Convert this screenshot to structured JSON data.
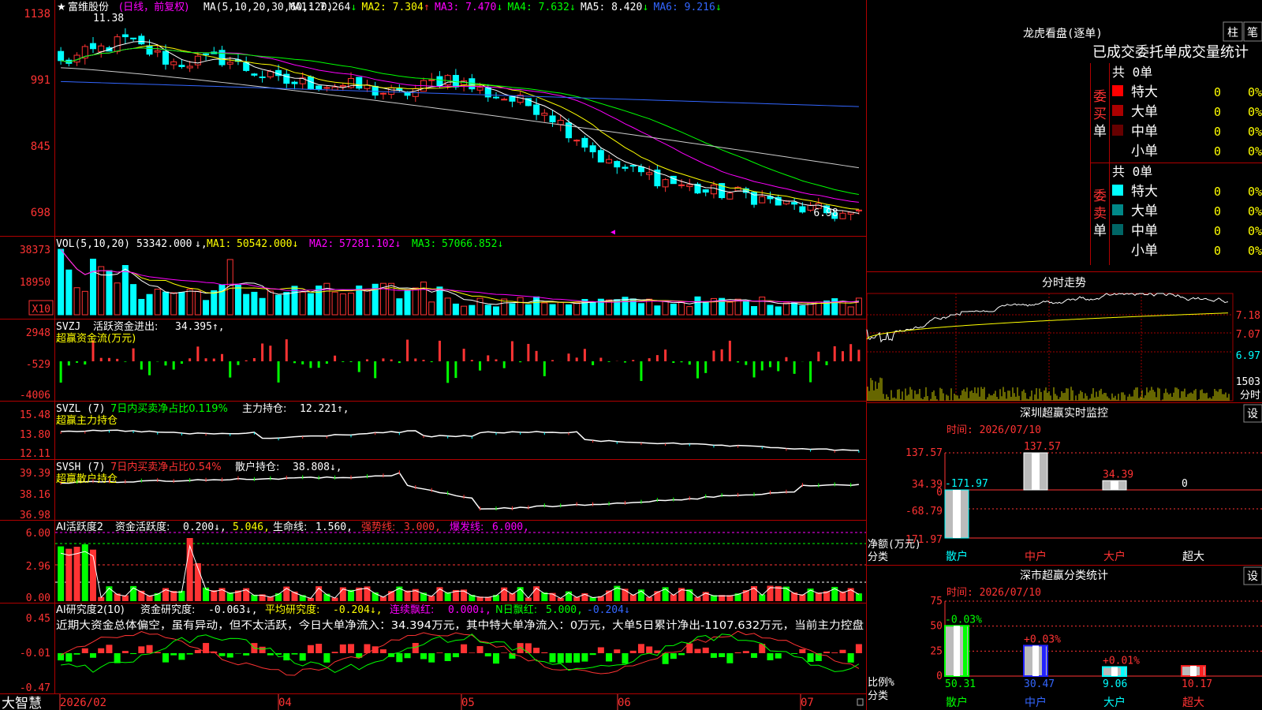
{
  "colors": {
    "up": "#ff3333",
    "down": "#00ffff",
    "grid": "#a00000",
    "yellow": "#ffff00",
    "green": "#00ff00",
    "magenta": "#ff00ff",
    "white": "#ffffff",
    "blue": "#3366ff"
  },
  "stock": {
    "name": "富维股份",
    "period": "(日线，前复权)",
    "ma_label": "MA(5,10,20,30,60,120)",
    "ma_values": [
      {
        "label": "MA1:",
        "value": "7.264",
        "arrow": "↓"
      },
      {
        "label": "MA2:",
        "value": "7.304",
        "arrow": "↑"
      },
      {
        "label": "MA3:",
        "value": "7.470",
        "arrow": "↓"
      },
      {
        "label": "MA4:",
        "value": "7.632",
        "arrow": "↓"
      },
      {
        "label": "MA5:",
        "value": "8.420",
        "arrow": "↓"
      },
      {
        "label": "MA6:",
        "value": "9.216",
        "arrow": "↓"
      }
    ],
    "high_mark": "11.38",
    "low_mark": "6.98"
  },
  "axes": {
    "price": [
      "1138",
      "991",
      "845",
      "698"
    ],
    "vol": [
      "38373",
      "18950",
      "X10"
    ],
    "svzj": [
      "2948",
      "-529",
      "-4006"
    ],
    "svzl": [
      "15.48",
      "13.80",
      "12.11"
    ],
    "svsh": [
      "39.39",
      "38.16",
      "36.98"
    ],
    "ai1": [
      "6.00",
      "2.96",
      "0.00"
    ],
    "ai2": [
      "0.45",
      "-0.01",
      "-0.47"
    ]
  },
  "dates": [
    "2026/02",
    "04",
    "05",
    "06",
    "07"
  ],
  "brand": "大智慧",
  "vol_header": {
    "title": "VOL(5,10,20)",
    "value": "53342.000",
    "ma1": "MA1:",
    "ma1v": "50542.000↓",
    "ma2": "MA2:",
    "ma2v": "57281.102↓",
    "ma3": "MA3:",
    "ma3v": "57066.852↓"
  },
  "svzj_header": {
    "title": "SVZJ",
    "label": "活跃资金进出:",
    "value": "34.395↑,",
    "sub": "超赢资金流(万元)"
  },
  "svzl_header": {
    "title": "SVZL (7)",
    "label": "7日内买卖净占比0.119%",
    "label2": "主力持仓:",
    "value": "12.221↑,",
    "sub": "超赢主力持仓"
  },
  "svsh_header": {
    "title": "SVSH (7)",
    "label": "7日内买卖净占比0.54%",
    "label2": "散户持仓:",
    "value": "38.808↓,",
    "sub": "超赢散户持仓"
  },
  "ai1_header": {
    "title": "AI活跃度2",
    "label": "资金活跃度:",
    "value": "0.200↓,",
    "v2": "5.046,",
    "label2": "生命线:",
    "v3": "1.560,",
    "label3": "强势线:",
    "v4": "3.000,",
    "label4": "爆发线:",
    "v5": "6.000,"
  },
  "ai2_header": {
    "title": "AI研究度2(10)",
    "label": "资金研究度:",
    "value": "-0.063↓,",
    "label2": "平均研究度:",
    "v2": "-0.204↓,",
    "label3": "连续飘红:",
    "v3": "0.000↓,",
    "label4": "N日飘红:",
    "v4": "5.000,",
    "v5": "-0.204↓"
  },
  "ai2_comment": "近期大资金总体偏空，虽有异动，但不太活跃，今日大单净流入：34.394万元，其中特大单净流入：0万元，大单5日累计净出-1107.632万元，当前主力控盘",
  "dragon": {
    "title": "龙虎看盘(逐单)",
    "btn1": "柱",
    "btn2": "笔",
    "subtitle": "已成交委托单成交量统计",
    "buy_label": "委买单",
    "buy_total": "共 0单",
    "sell_label": "委卖单",
    "sell_total": "共 0单",
    "buy_rows": [
      {
        "name": "特大",
        "count": "0",
        "pct": "0%",
        "color": "#ff0000"
      },
      {
        "name": "大单",
        "count": "0",
        "pct": "0%",
        "color": "#aa0000"
      },
      {
        "name": "中单",
        "count": "0",
        "pct": "0%",
        "color": "#660000"
      },
      {
        "name": "小单",
        "count": "0",
        "pct": "0%",
        "color": ""
      }
    ],
    "sell_rows": [
      {
        "name": "特大",
        "count": "0",
        "pct": "0%",
        "color": "#00ffff"
      },
      {
        "name": "大单",
        "count": "0",
        "pct": "0%",
        "color": "#008888"
      },
      {
        "name": "中单",
        "count": "0",
        "pct": "0%",
        "color": "#006666"
      },
      {
        "name": "小单",
        "count": "0",
        "pct": "0%",
        "color": ""
      }
    ]
  },
  "intraday": {
    "title": "分时走势",
    "prices": [
      "7.18",
      "7.07",
      "6.97"
    ],
    "vol": "1503",
    "vol_label": "分时"
  },
  "monitor": {
    "title": "深圳超赢实时监控",
    "btn": "设",
    "time": "时间: 2026/07/10",
    "y_labels": [
      "137.57",
      "34.39",
      "0",
      "-68.79",
      "-171.97"
    ],
    "axis_title": "净额(万元)",
    "axis_title2": "分类",
    "bars": [
      {
        "name": "散户",
        "value": -171.97,
        "label": "-171.97"
      },
      {
        "name": "中户",
        "value": 137.57,
        "label": "137.57"
      },
      {
        "name": "大户",
        "value": 34.39,
        "label": "34.39"
      },
      {
        "name": "超大",
        "value": 0,
        "label": "0"
      }
    ]
  },
  "classify": {
    "title": "深市超赢分类统计",
    "btn": "设",
    "time": "时间: 2026/07/10",
    "y_labels": [
      "75",
      "50",
      "25",
      "0"
    ],
    "axis_title": "比例%",
    "axis_title2": "分类",
    "bars": [
      {
        "name": "散户",
        "value": 50.31,
        "label": "50.31",
        "change": "-0.03%",
        "color": "#00ff00"
      },
      {
        "name": "中户",
        "value": 30.47,
        "label": "30.47",
        "change": "+0.03%",
        "color": "#2222ff"
      },
      {
        "name": "大户",
        "value": 9.06,
        "label": "9.06",
        "change": "+0.01%",
        "color": "#00ffff"
      },
      {
        "name": "超大",
        "value": 10.17,
        "label": "10.17",
        "change": "",
        "color": "#ff2222"
      }
    ]
  }
}
